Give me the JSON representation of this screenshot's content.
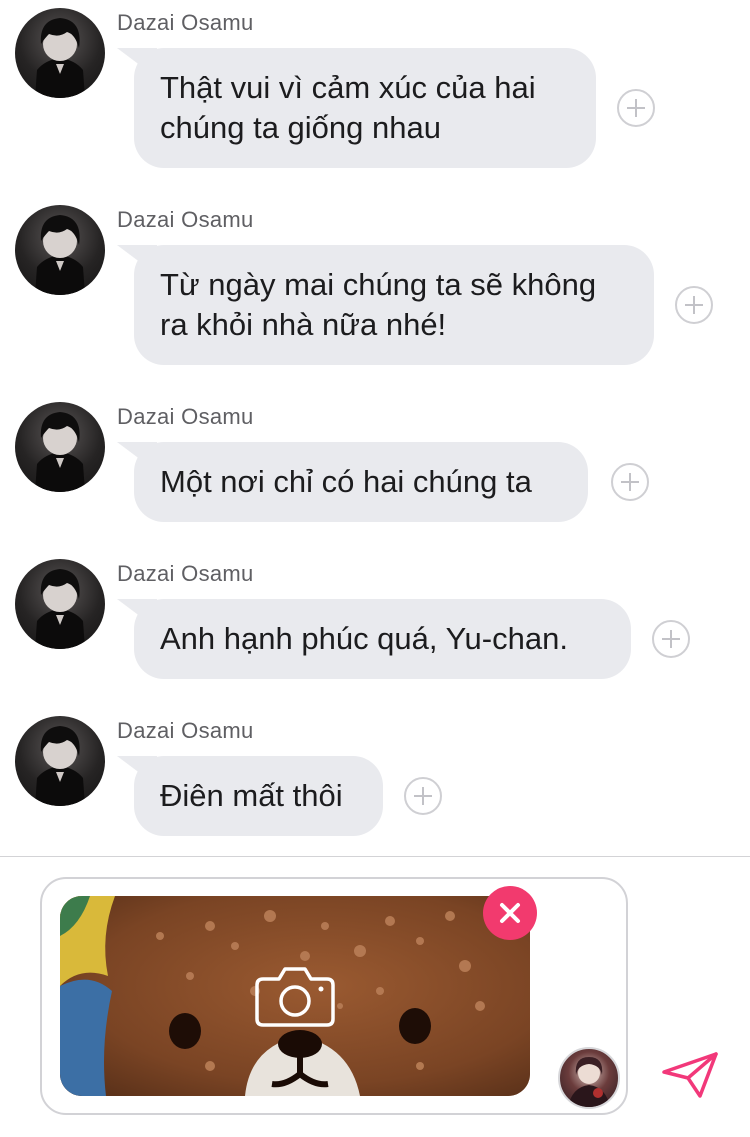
{
  "messages": [
    {
      "sender": "Dazai Osamu",
      "lines": [
        "Thật vui vì cảm xúc của hai",
        "chúng ta giống nhau"
      ]
    },
    {
      "sender": "Dazai Osamu",
      "lines": [
        "Từ ngày mai chúng ta sẽ không",
        "ra khỏi nhà nữa nhé!"
      ]
    },
    {
      "sender": "Dazai Osamu",
      "lines": [
        "Một nơi chỉ có hai chúng ta"
      ]
    },
    {
      "sender": "Dazai Osamu",
      "lines": [
        "Anh hạnh phúc quá, Yu-chan."
      ]
    },
    {
      "sender": "Dazai Osamu",
      "lines": [
        "Điên mất thôi"
      ]
    }
  ],
  "composer": {
    "attachment_icon": "camera-icon",
    "remove_icon": "close-icon",
    "send_icon": "paper-plane-icon",
    "send_color": "#f2387a",
    "remove_color": "#f23a6e"
  },
  "colors": {
    "bubble": "#e9eaee",
    "sender_text": "#5f5f63"
  }
}
